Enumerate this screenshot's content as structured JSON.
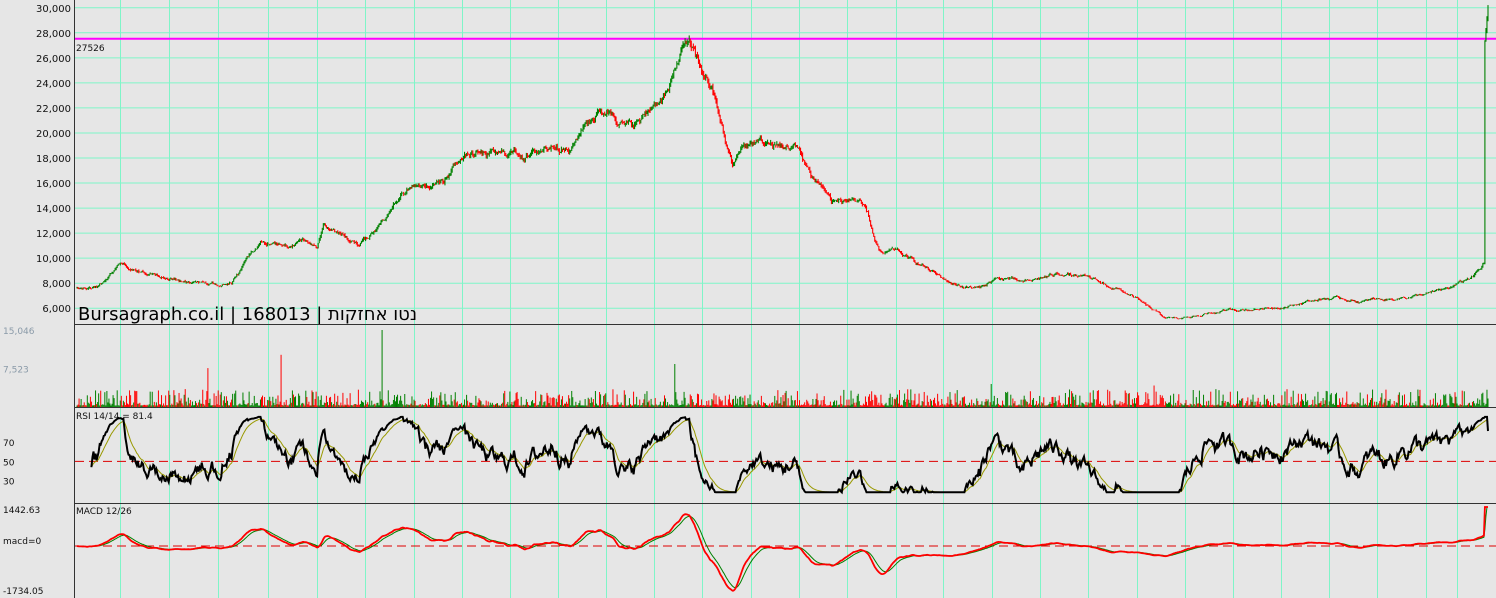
{
  "chart_data": [
    {
      "type": "line",
      "panel": "price",
      "title": "Bursagraph.co.il | 168013 | נטו אחזקות",
      "y_ticks": [
        "30,000",
        "28,000",
        "26,000",
        "24,000",
        "22,000",
        "20,000",
        "18,000",
        "16,000",
        "14,000",
        "12,000",
        "10,000",
        "8,000",
        "6,000"
      ],
      "y_tick_values": [
        30000,
        28000,
        26000,
        24000,
        22000,
        20000,
        18000,
        16000,
        14000,
        12000,
        10000,
        8000,
        6000
      ],
      "ylim": [
        4900,
        30300
      ],
      "grid": true,
      "level": {
        "label": "27526",
        "value": 27526,
        "color": "#ff00ff"
      },
      "colors": {
        "up": "#008000",
        "down": "#ff0000",
        "background": "#e6e6e6",
        "grid": "#7ff5c8"
      },
      "close_keypoints": [
        [
          0,
          7600
        ],
        [
          0.014,
          7650
        ],
        [
          0.024,
          8800
        ],
        [
          0.03,
          9400
        ],
        [
          0.045,
          8900
        ],
        [
          0.06,
          8500
        ],
        [
          0.08,
          8000
        ],
        [
          0.1,
          8000
        ],
        [
          0.11,
          8200
        ],
        [
          0.115,
          8800
        ],
        [
          0.12,
          9800
        ],
        [
          0.13,
          11300
        ],
        [
          0.14,
          11200
        ],
        [
          0.15,
          10800
        ],
        [
          0.16,
          11300
        ],
        [
          0.17,
          11000
        ],
        [
          0.175,
          12600
        ],
        [
          0.18,
          12200
        ],
        [
          0.19,
          11500
        ],
        [
          0.2,
          11200
        ],
        [
          0.205,
          11600
        ],
        [
          0.21,
          12000
        ],
        [
          0.22,
          13400
        ],
        [
          0.23,
          15400
        ],
        [
          0.24,
          16100
        ],
        [
          0.25,
          15800
        ],
        [
          0.26,
          16000
        ],
        [
          0.27,
          18000
        ],
        [
          0.28,
          18300
        ],
        [
          0.3,
          18200
        ],
        [
          0.31,
          18500
        ],
        [
          0.32,
          18200
        ],
        [
          0.33,
          18700
        ],
        [
          0.34,
          19300
        ],
        [
          0.35,
          18600
        ],
        [
          0.36,
          20800
        ],
        [
          0.37,
          21700
        ],
        [
          0.38,
          21800
        ],
        [
          0.39,
          20500
        ],
        [
          0.4,
          21000
        ],
        [
          0.41,
          22500
        ],
        [
          0.42,
          23500
        ],
        [
          0.425,
          25200
        ],
        [
          0.43,
          27300
        ],
        [
          0.436,
          26500
        ],
        [
          0.445,
          24500
        ],
        [
          0.45,
          23500
        ],
        [
          0.455,
          21500
        ],
        [
          0.46,
          19000
        ],
        [
          0.465,
          17200
        ],
        [
          0.47,
          18800
        ],
        [
          0.48,
          19300
        ],
        [
          0.49,
          19100
        ],
        [
          0.5,
          18800
        ],
        [
          0.505,
          19000
        ],
        [
          0.51,
          18800
        ],
        [
          0.515,
          17800
        ],
        [
          0.52,
          16700
        ],
        [
          0.53,
          15500
        ],
        [
          0.535,
          14500
        ],
        [
          0.545,
          14500
        ],
        [
          0.55,
          14800
        ],
        [
          0.555,
          14200
        ],
        [
          0.56,
          13500
        ],
        [
          0.565,
          11600
        ],
        [
          0.57,
          10200
        ],
        [
          0.58,
          10600
        ],
        [
          0.59,
          9900
        ],
        [
          0.6,
          9400
        ],
        [
          0.61,
          8600
        ],
        [
          0.62,
          8000
        ],
        [
          0.63,
          7700
        ],
        [
          0.64,
          7600
        ],
        [
          0.65,
          8300
        ],
        [
          0.66,
          8400
        ],
        [
          0.67,
          8000
        ],
        [
          0.68,
          8300
        ],
        [
          0.69,
          8600
        ],
        [
          0.7,
          8800
        ],
        [
          0.71,
          8500
        ],
        [
          0.72,
          8300
        ],
        [
          0.73,
          7800
        ],
        [
          0.74,
          7400
        ],
        [
          0.75,
          6800
        ],
        [
          0.76,
          6000
        ],
        [
          0.77,
          5300
        ],
        [
          0.78,
          5100
        ],
        [
          0.79,
          5300
        ],
        [
          0.8,
          5600
        ],
        [
          0.81,
          5700
        ],
        [
          0.82,
          5900
        ],
        [
          0.83,
          5900
        ],
        [
          0.84,
          6000
        ],
        [
          0.85,
          6100
        ],
        [
          0.86,
          6200
        ],
        [
          0.87,
          6500
        ],
        [
          0.88,
          6700
        ],
        [
          0.89,
          6800
        ],
        [
          0.9,
          6700
        ],
        [
          0.91,
          6500
        ],
        [
          0.92,
          6700
        ],
        [
          0.93,
          6700
        ],
        [
          0.94,
          6900
        ],
        [
          0.95,
          7000
        ],
        [
          0.96,
          7200
        ],
        [
          0.97,
          7500
        ],
        [
          0.975,
          7700
        ],
        [
          0.98,
          8000
        ],
        [
          0.99,
          8600
        ],
        [
          1.0,
          9800
        ]
      ]
    },
    {
      "type": "bar",
      "panel": "volume",
      "y_ticks": [
        "15,046",
        "7,523"
      ],
      "y_tick_values": [
        15046,
        7523
      ],
      "ylim": [
        0,
        15046
      ],
      "colors": {
        "up": "#008000",
        "down": "#ff0000"
      }
    },
    {
      "type": "line",
      "panel": "rsi",
      "title": "RSI 14/14 = 81.4",
      "y_ticks": [
        "70",
        "50",
        "30"
      ],
      "y_tick_values": [
        70,
        50,
        30
      ],
      "ylim": [
        10,
        100
      ],
      "reference_line": 50,
      "last_value": 81.4,
      "colors": {
        "rsi": "#000000",
        "signal": "#999900",
        "reference": "#dd0000"
      }
    },
    {
      "type": "line",
      "panel": "macd",
      "title": "MACD 12/26",
      "y_ticks": [
        "1442.63",
        "macd=0",
        "-1734.05"
      ],
      "ylim": [
        -1734.05,
        1442.63
      ],
      "zero_line": 0,
      "colors": {
        "macd": "#ff0000",
        "signal": "#008000",
        "zero": "#dd0000"
      }
    }
  ]
}
